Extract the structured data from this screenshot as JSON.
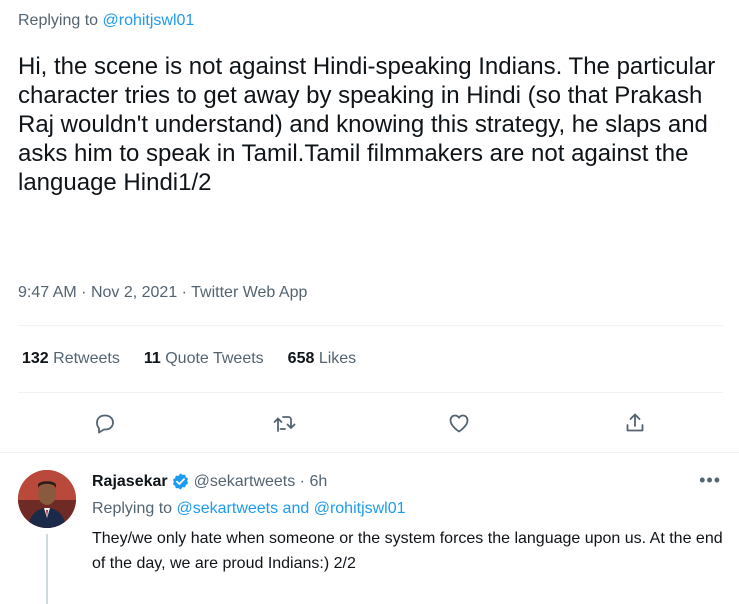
{
  "main_tweet": {
    "replying_prefix": "Replying to",
    "replying_to": "@rohitjswl01",
    "text": "Hi, the scene is not against Hindi-speaking Indians. The particular character tries to get away by speaking in Hindi (so that Prakash Raj wouldn't understand) and knowing this strategy, he slaps and asks him to speak in Tamil.Tamil filmmakers are not against the language Hindi1/2",
    "time": "9:47 AM",
    "date": "Nov 2, 2021",
    "source": "Twitter Web App",
    "stats": {
      "retweets_count": "132",
      "retweets_label": "Retweets",
      "quote_count": "11",
      "quote_label": "Quote Tweets",
      "likes_count": "658",
      "likes_label": "Likes"
    },
    "actions": [
      "reply-icon",
      "retweet-icon",
      "like-icon",
      "share-icon"
    ]
  },
  "reply": {
    "name": "Rajasekar",
    "handle": "@sekartweets",
    "time": "6h",
    "replying_prefix": "Replying to",
    "replying_to": "@sekartweets and @rohitjswl01",
    "text": "They/we only hate when someone or the system forces the language upon us. At the end of the day, we are proud Indians:) 2/2",
    "more": "•••"
  },
  "colors": {
    "accent": "#1d9bf0",
    "muted": "#536471",
    "text": "#0f1419",
    "divider": "#eff3f4"
  }
}
